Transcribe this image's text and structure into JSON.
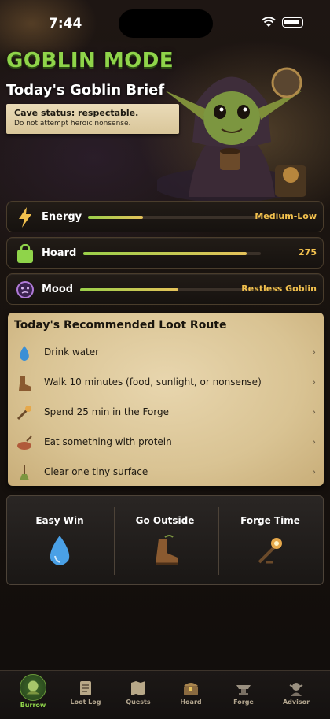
{
  "status_bar": {
    "time": "7:44"
  },
  "header": {
    "app_title": "GOBLIN MODE",
    "brief_title": "Today's Goblin Brief",
    "note_line1": "Cave status: respectable.",
    "note_line2": "Do not attempt heroic nonsense."
  },
  "stats": [
    {
      "label": "Energy",
      "value": "Medium-Low",
      "level": 0.32,
      "icon": "lightning-icon"
    },
    {
      "label": "Hoard",
      "value": "275",
      "level": 0.92,
      "icon": "bag-icon"
    },
    {
      "label": "Mood",
      "value": "Restless Goblin",
      "level": 0.57,
      "icon": "mood-face-icon"
    }
  ],
  "loot_route": {
    "title": "Today's Recommended Loot Route",
    "items": [
      {
        "label": "Drink water",
        "icon": "water-drop-icon"
      },
      {
        "label": "Walk 10 minutes (food, sunlight, or nonsense)",
        "icon": "boot-icon"
      },
      {
        "label": "Spend 25 min in the Forge",
        "icon": "forge-icon"
      },
      {
        "label": "Eat something with protein",
        "icon": "food-icon"
      },
      {
        "label": "Clear one tiny surface",
        "icon": "broom-icon"
      }
    ]
  },
  "quick_actions": [
    {
      "label": "Easy Win",
      "icon": "water-drop-icon"
    },
    {
      "label": "Go Outside",
      "icon": "boot-icon"
    },
    {
      "label": "Forge Time",
      "icon": "forge-icon"
    }
  ],
  "tabs": [
    {
      "label": "Burrow",
      "icon": "burrow-icon",
      "active": true
    },
    {
      "label": "Loot Log",
      "icon": "scroll-icon"
    },
    {
      "label": "Quests",
      "icon": "map-icon"
    },
    {
      "label": "Hoard",
      "icon": "chest-icon"
    },
    {
      "label": "Forge",
      "icon": "anvil-icon"
    },
    {
      "label": "Advisor",
      "icon": "goblin-advisor-icon"
    }
  ],
  "colors": {
    "accent_green": "#8fd44a",
    "gold": "#f2c14e",
    "parchment": "#e0cc9f"
  }
}
